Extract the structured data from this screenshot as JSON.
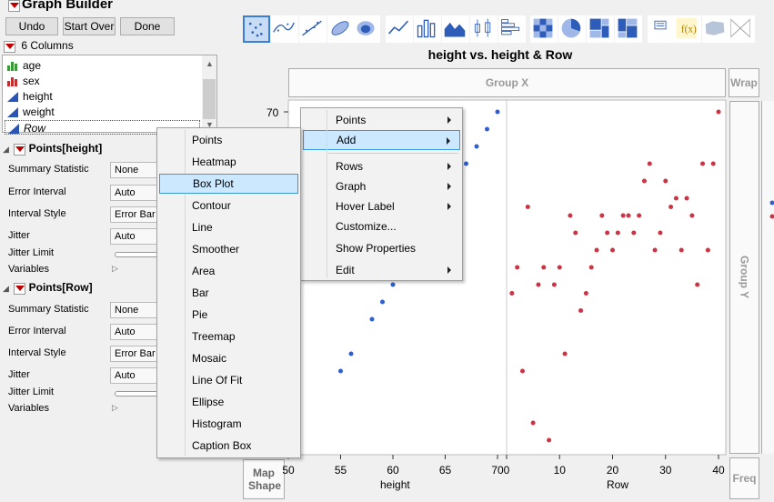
{
  "window": {
    "title": "Graph Builder"
  },
  "top_buttons": {
    "undo": "Undo",
    "start_over": "Start Over",
    "done": "Done"
  },
  "columns": {
    "header": "6 Columns",
    "items": [
      {
        "label": "age",
        "icon": "nominal-bar-icon"
      },
      {
        "label": "sex",
        "icon": "nominal-bar-icon"
      },
      {
        "label": "height",
        "icon": "continuous-icon"
      },
      {
        "label": "weight",
        "icon": "continuous-icon"
      },
      {
        "label": "Row",
        "icon": "continuous-icon"
      }
    ]
  },
  "points_height": {
    "title": "Points[height]",
    "summary_statistic_label": "Summary Statistic",
    "summary_statistic": "None",
    "error_interval_label": "Error Interval",
    "error_interval": "Auto",
    "interval_style_label": "Interval Style",
    "interval_style": "Error Bar",
    "jitter_label": "Jitter",
    "jitter": "Auto",
    "jitter_limit_label": "Jitter Limit",
    "variables_label": "Variables"
  },
  "points_row": {
    "title": "Points[Row]",
    "summary_statistic_label": "Summary Statistic",
    "summary_statistic": "None",
    "error_interval_label": "Error Interval",
    "error_interval": "Auto",
    "interval_style_label": "Interval Style",
    "interval_style": "Error Bar",
    "jitter_label": "Jitter",
    "jitter": "Auto",
    "jitter_limit_label": "Jitter Limit",
    "variables_label": "Variables"
  },
  "toolbar_icons": [
    "points-icon",
    "smoother-icon",
    "line-of-fit-icon",
    "ellipse-icon",
    "contour-icon",
    "line-icon",
    "bar-icon",
    "area-icon",
    "box-plot-icon",
    "histogram-icon",
    "heatmap-icon",
    "pie-icon",
    "treemap-icon",
    "mosaic-icon",
    "caption-box-icon",
    "formula-icon",
    "map-shape-icon",
    "parallel-icon"
  ],
  "graph": {
    "title": "height vs. height & Row",
    "group_x": "Group X",
    "group_y": "Group Y",
    "wrap": "Wrap",
    "freq": "Freq",
    "map_shape": "Map Shape",
    "left_x_label": "height",
    "right_x_label": "Row",
    "y_tick_label": "70"
  },
  "context_menu": {
    "items": [
      "Points",
      "Add",
      "Rows",
      "Graph",
      "Hover Label",
      "Customize...",
      "Show Properties",
      "Edit"
    ],
    "highlighted": "Add"
  },
  "add_submenu": {
    "items": [
      "Points",
      "Heatmap",
      "Box Plot",
      "Contour",
      "Line",
      "Smoother",
      "Area",
      "Bar",
      "Pie",
      "Treemap",
      "Mosaic",
      "Line Of Fit",
      "Ellipse",
      "Histogram",
      "Caption Box"
    ],
    "highlighted": "Box Plot"
  },
  "chart_data": [
    {
      "type": "scatter",
      "title": "height vs. height & Row",
      "xlabel": "height",
      "ylabel": "",
      "xlim": [
        50,
        70
      ],
      "x_ticks": [
        "50",
        "55",
        "60",
        "65",
        "70"
      ],
      "y_ticks": [
        "70"
      ],
      "color": "#2e5fd0",
      "points": [
        [
          51,
          52
        ],
        [
          55,
          55
        ],
        [
          56,
          56
        ],
        [
          58,
          58
        ],
        [
          59,
          59
        ],
        [
          60,
          60
        ],
        [
          66,
          66
        ],
        [
          67,
          67
        ],
        [
          68,
          68
        ],
        [
          69,
          69
        ],
        [
          70,
          70
        ]
      ]
    },
    {
      "type": "scatter",
      "xlabel": "Row",
      "xlim": [
        0,
        40
      ],
      "x_ticks": [
        "0",
        "10",
        "20",
        "30",
        "40"
      ],
      "color": "#cc3344",
      "points": [
        [
          1,
          59.5
        ],
        [
          2,
          61
        ],
        [
          3,
          55
        ],
        [
          4,
          64.5
        ],
        [
          5,
          52
        ],
        [
          6,
          60
        ],
        [
          7,
          61
        ],
        [
          8,
          51
        ],
        [
          9,
          60
        ],
        [
          10,
          61
        ],
        [
          11,
          56
        ],
        [
          12,
          64
        ],
        [
          13,
          63
        ],
        [
          14,
          58.5
        ],
        [
          15,
          59.5
        ],
        [
          16,
          61
        ],
        [
          17,
          62
        ],
        [
          18,
          64
        ],
        [
          19,
          63
        ],
        [
          20,
          62
        ],
        [
          21,
          63
        ],
        [
          22,
          64
        ],
        [
          23,
          64
        ],
        [
          24,
          63
        ],
        [
          25,
          64
        ],
        [
          26,
          66
        ],
        [
          27,
          67
        ],
        [
          28,
          62
        ],
        [
          29,
          63
        ],
        [
          30,
          66
        ],
        [
          31,
          64.5
        ],
        [
          32,
          65
        ],
        [
          33,
          62
        ],
        [
          34,
          65
        ],
        [
          35,
          64
        ],
        [
          36,
          60
        ],
        [
          37,
          67
        ],
        [
          38,
          62
        ],
        [
          39,
          67
        ],
        [
          40,
          70
        ]
      ]
    }
  ]
}
